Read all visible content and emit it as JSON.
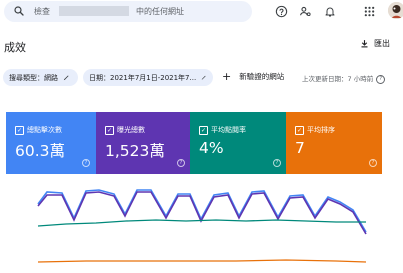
{
  "search": {
    "prefix": "檢查",
    "suffix": "中的任何網址"
  },
  "header": {
    "title": "成效",
    "export_label": "匯出"
  },
  "filters": {
    "search_type": "搜尋類型：網路",
    "date_range": "日期：2021年7月1日-2021年7...",
    "add_label": "新驗證的網站",
    "last_updated": "上次更新日期：7 小時前"
  },
  "metrics": [
    {
      "label": "總點擊次數",
      "value": "60.3萬",
      "color": "#4285f4"
    },
    {
      "label": "曝光總數",
      "value": "1,523萬",
      "color": "#5e35b1"
    },
    {
      "label": "平均點閱率",
      "value": "4%",
      "color": "#00897b"
    },
    {
      "label": "平均排序",
      "value": "7",
      "color": "#e8710a"
    }
  ],
  "icons": {
    "search": "search-icon",
    "help": "help-circle-icon",
    "people": "manage-users-icon",
    "bell": "notifications-icon",
    "apps": "apps-grid-icon",
    "avatar": "avatar",
    "export": "download-icon",
    "edit": "pencil-icon"
  }
}
